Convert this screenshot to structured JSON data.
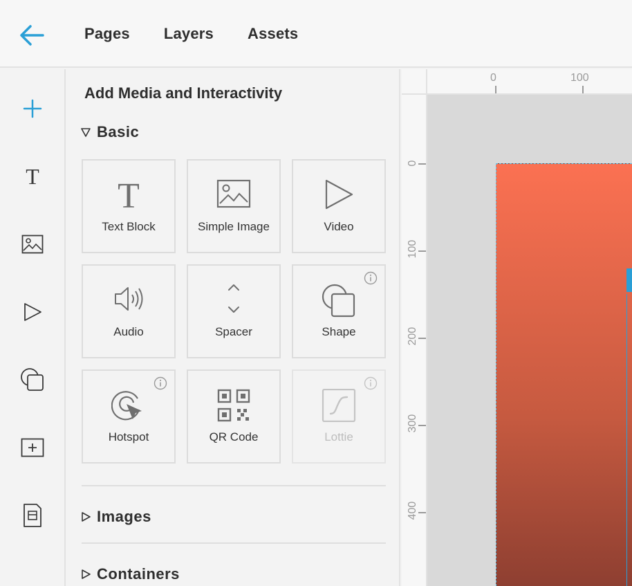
{
  "topbar": {
    "tabs": [
      "Pages",
      "Layers",
      "Assets"
    ]
  },
  "rail": {
    "items": [
      "add-icon",
      "text-icon",
      "image-icon",
      "video-icon",
      "shape-icon",
      "container-icon",
      "page-icon"
    ],
    "accent": "#2a9fd6"
  },
  "panel": {
    "title": "Add Media and Interactivity",
    "basic": {
      "label": "Basic",
      "tiles": [
        {
          "label": "Text Block"
        },
        {
          "label": "Simple Image"
        },
        {
          "label": "Video"
        },
        {
          "label": "Audio"
        },
        {
          "label": "Spacer"
        },
        {
          "label": "Shape"
        },
        {
          "label": "Hotspot"
        },
        {
          "label": "QR Code"
        },
        {
          "label": "Lottie"
        }
      ]
    },
    "images": {
      "label": "Images"
    },
    "containers": {
      "label": "Containers"
    }
  },
  "ruler": {
    "top": [
      "0",
      "100"
    ],
    "left": [
      "0",
      "100",
      "200",
      "300",
      "400"
    ]
  }
}
